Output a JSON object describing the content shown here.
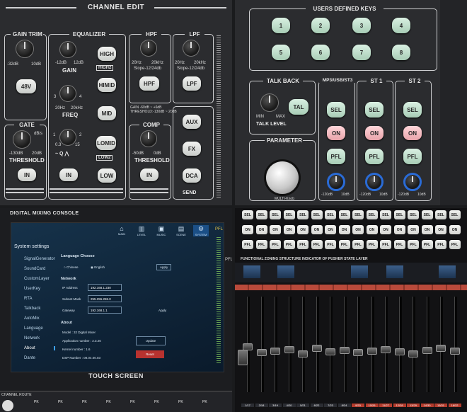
{
  "channel_edit": {
    "title": "CHANNEL EDIT",
    "gain_trim": {
      "title": "GAIN TRIM",
      "min": "-32dB",
      "max": "10dB",
      "btn": "48V"
    },
    "gate": {
      "title": "GATE",
      "unit": "dB/s",
      "min": "-130dB",
      "max": "20dB",
      "label": "THRESHOLD",
      "btn": "IN"
    },
    "equalizer": {
      "title": "EQUALIZER",
      "gain_min": "-12dB",
      "gain_max": "12dB",
      "gain_label": "GAIN",
      "freq_min": "20Hz",
      "freq_max": "20kHz",
      "freq_label": "FREQ",
      "q_left": "0.3",
      "q_right": "15",
      "q_label": "Q",
      "q_one": "1",
      "q_two": "2",
      "q_three": "3",
      "q_four": "4",
      "btn_high": "HIGH",
      "btn_himid": "HIMID",
      "btn_mid": "MID",
      "btn_lomid": "LOMID",
      "btn_low": "LOW",
      "btn_in": "IN",
      "tag_high": "HIGH2",
      "tag_low": "LOW2"
    },
    "hpf": {
      "title": "HPF",
      "min": "20Hz",
      "max": "20kHz",
      "slope": "Slope-12/24db",
      "btn": "HPF"
    },
    "lpf": {
      "title": "LPF",
      "min": "20Hz",
      "max": "20kHz",
      "slope": "Slope-12/24db",
      "btn": "LPF"
    },
    "comp": {
      "title": "COMP",
      "info1": "GAIN -60dB ~ +6dB",
      "info2": "THRESHOLD:-130dB ~ 20dB",
      "min": "-50dB",
      "max": "0dB",
      "label": "THRESHOLD",
      "btn": "IN"
    },
    "send": {
      "title": "SEND",
      "btn_aux": "AUX",
      "btn_fx": "FX",
      "btn_dca": "DCA"
    }
  },
  "users_keys": {
    "title": "USERS DEFINED KEYS",
    "keys": [
      "1",
      "2",
      "3",
      "4",
      "5",
      "6",
      "7",
      "8"
    ]
  },
  "talkback": {
    "title": "TALK BACK",
    "min": "MIN",
    "max": "MAX",
    "label": "TALK LEVEL",
    "btn": "TAL"
  },
  "parameter": {
    "title": "PARAMETER",
    "caption": "MULTI-Knob"
  },
  "strips": [
    {
      "title": "MP3/USB/ST3",
      "sel": "SEL",
      "on": "ON",
      "pfl": "PFL",
      "min": "-120dB",
      "max": "10dB"
    },
    {
      "title": "ST 1",
      "sel": "SEL",
      "on": "ON",
      "pfl": "PFL",
      "min": "-120dB",
      "max": "10dB"
    },
    {
      "title": "ST 2",
      "sel": "SEL",
      "on": "ON",
      "pfl": "PFL",
      "min": "-120dB",
      "max": "10dB"
    }
  ],
  "console": {
    "brand": "DIGITAL MIXING CONSOLE",
    "footer": "TOUCH SCREEN",
    "fader_label": "PFL",
    "route": "CHANNEL ROUTE",
    "pk": "PK",
    "screen": {
      "heading": "System settings",
      "nav": [
        "MAIN",
        "LEVEL",
        "MUSIC",
        "SCENE",
        "SYSTEM"
      ],
      "side": [
        "SignalGenerator",
        "SoundCard",
        "CustomLayer",
        "UserKey",
        "RTA",
        "Talkback",
        "AutoMix",
        "Language",
        "Network",
        "About",
        "Dante"
      ],
      "active_side": "About",
      "lang_title": "Language Choose",
      "lang_cn": "Chinese",
      "lang_en": "English",
      "apply": "Apply",
      "net_title": "Network",
      "ip_label": "IP Address",
      "ip": "192.168.1.230",
      "mask_label": "Subnet Mask",
      "mask": "255.255.255.0",
      "gw_label": "Gateway",
      "gw": "192.168.1.1",
      "net_apply": "Apply",
      "about_title": "About",
      "model": "Model : 32 Digital Mixer",
      "app": "Application number : 2.3.26",
      "kernel": "Kernel number : 1.6",
      "dsp": "DSP Number : 08.04.00.03",
      "update": "Update",
      "reset": "Reset"
    }
  },
  "surface": {
    "indicator_title": "FUNCTIONAL ZONING STRUCTURE INDICATOR OF PUSHER STATE LAYER",
    "sel": "SEL",
    "on": "ON",
    "pfl": "PFL",
    "channels": [
      "1/17",
      "2/18",
      "3/19",
      "4/20",
      "5/21",
      "6/22",
      "7/23",
      "8/24",
      "9/33",
      "10/26",
      "11/27",
      "12/28",
      "13/29",
      "14/30",
      "15/31",
      "16/32"
    ]
  },
  "colors": {
    "panel": "#2b2c2f",
    "accent_blue": "#2a6bd6",
    "reset_red": "#b8322f",
    "on_pink": "#ffd5d9",
    "sel_green": "#d9f0e2"
  }
}
